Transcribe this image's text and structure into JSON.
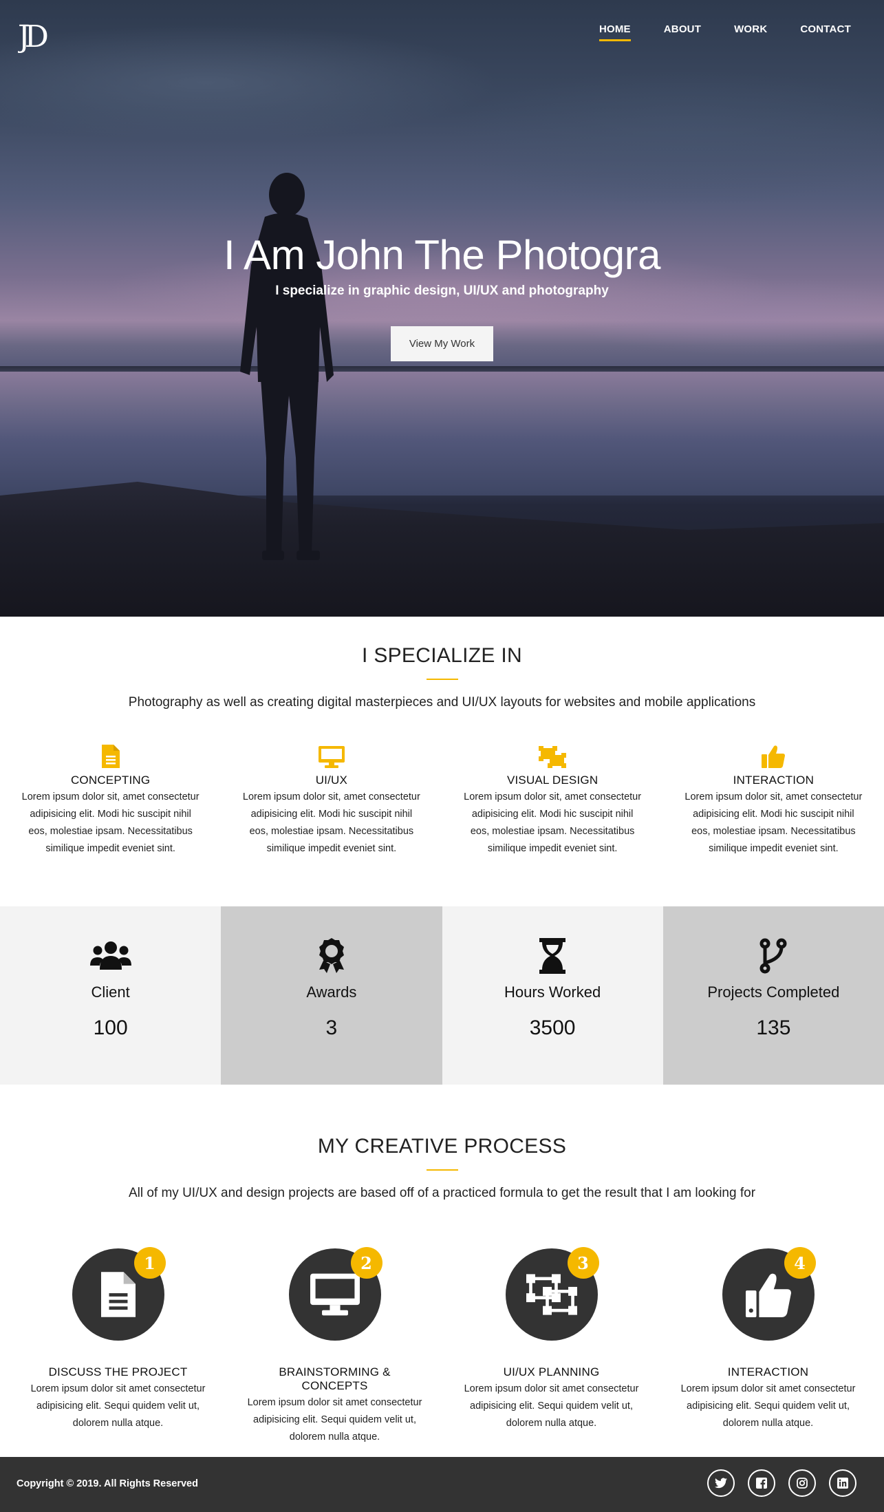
{
  "colors": {
    "accent": "#f5b800",
    "dark": "#333333",
    "stat_light": "#f3f3f3",
    "stat_dark": "#cccccc"
  },
  "header": {
    "logo": "JD",
    "nav": [
      {
        "label": "HOME",
        "active": true
      },
      {
        "label": "ABOUT",
        "active": false
      },
      {
        "label": "WORK",
        "active": false
      },
      {
        "label": "CONTACT",
        "active": false
      }
    ]
  },
  "hero": {
    "title": "I Am John The Photogra",
    "subtitle": "I specialize in graphic design, UI/UX and photography",
    "button": "View My Work"
  },
  "specialize": {
    "title": "I SPECIALIZE IN",
    "lead": "Photography as well as creating digital masterpieces and UI/UX layouts for websites and mobile applications",
    "items": [
      {
        "icon": "file-icon",
        "title": "CONCEPTING",
        "text": "Lorem ipsum dolor sit, amet consectetur adipisicing elit. Modi hic suscipit nihil eos, molestiae ipsam. Necessitatibus similique impedit eveniet sint."
      },
      {
        "icon": "desktop-icon",
        "title": "UI/UX",
        "text": "Lorem ipsum dolor sit, amet consectetur adipisicing elit. Modi hic suscipit nihil eos, molestiae ipsam. Necessitatibus similique impedit eveniet sint."
      },
      {
        "icon": "object-ungroup-icon",
        "title": "VISUAL DESIGN",
        "text": "Lorem ipsum dolor sit, amet consectetur adipisicing elit. Modi hic suscipit nihil eos, molestiae ipsam. Necessitatibus similique impedit eveniet sint."
      },
      {
        "icon": "thumbs-up-icon",
        "title": "INTERACTION",
        "text": "Lorem ipsum dolor sit, amet consectetur adipisicing elit. Modi hic suscipit nihil eos, molestiae ipsam. Necessitatibus similique impedit eveniet sint."
      }
    ]
  },
  "stats": [
    {
      "icon": "users-icon",
      "label": "Client",
      "value": "100"
    },
    {
      "icon": "award-icon",
      "label": "Awards",
      "value": "3"
    },
    {
      "icon": "hourglass-icon",
      "label": "Hours Worked",
      "value": "3500"
    },
    {
      "icon": "code-branch-icon",
      "label": "Projects Completed",
      "value": "135"
    }
  ],
  "process": {
    "title": "MY CREATIVE PROCESS",
    "lead": "All of my UI/UX and design projects are based off of a practiced formula to get the result that I am looking for",
    "steps": [
      {
        "number": "1",
        "icon": "file-icon",
        "title": "DISCUSS THE PROJECT",
        "text": "Lorem ipsum dolor sit amet consectetur adipisicing elit. Sequi quidem velit ut, dolorem nulla atque."
      },
      {
        "number": "2",
        "icon": "desktop-icon",
        "title": "BRAINSTORMING & CONCEPTS",
        "text": "Lorem ipsum dolor sit amet consectetur adipisicing elit. Sequi quidem velit ut, dolorem nulla atque."
      },
      {
        "number": "3",
        "icon": "object-ungroup-icon",
        "title": "UI/UX PLANNING",
        "text": "Lorem ipsum dolor sit amet consectetur adipisicing elit. Sequi quidem velit ut, dolorem nulla atque."
      },
      {
        "number": "4",
        "icon": "thumbs-up-icon",
        "title": "INTERACTION",
        "text": "Lorem ipsum dolor sit amet consectetur adipisicing elit. Sequi quidem velit ut, dolorem nulla atque."
      }
    ]
  },
  "footer": {
    "copyright": "Copyright © 2019. All Rights Reserved",
    "socials": [
      "twitter-icon",
      "facebook-icon",
      "instagram-icon",
      "linkedin-icon"
    ]
  }
}
